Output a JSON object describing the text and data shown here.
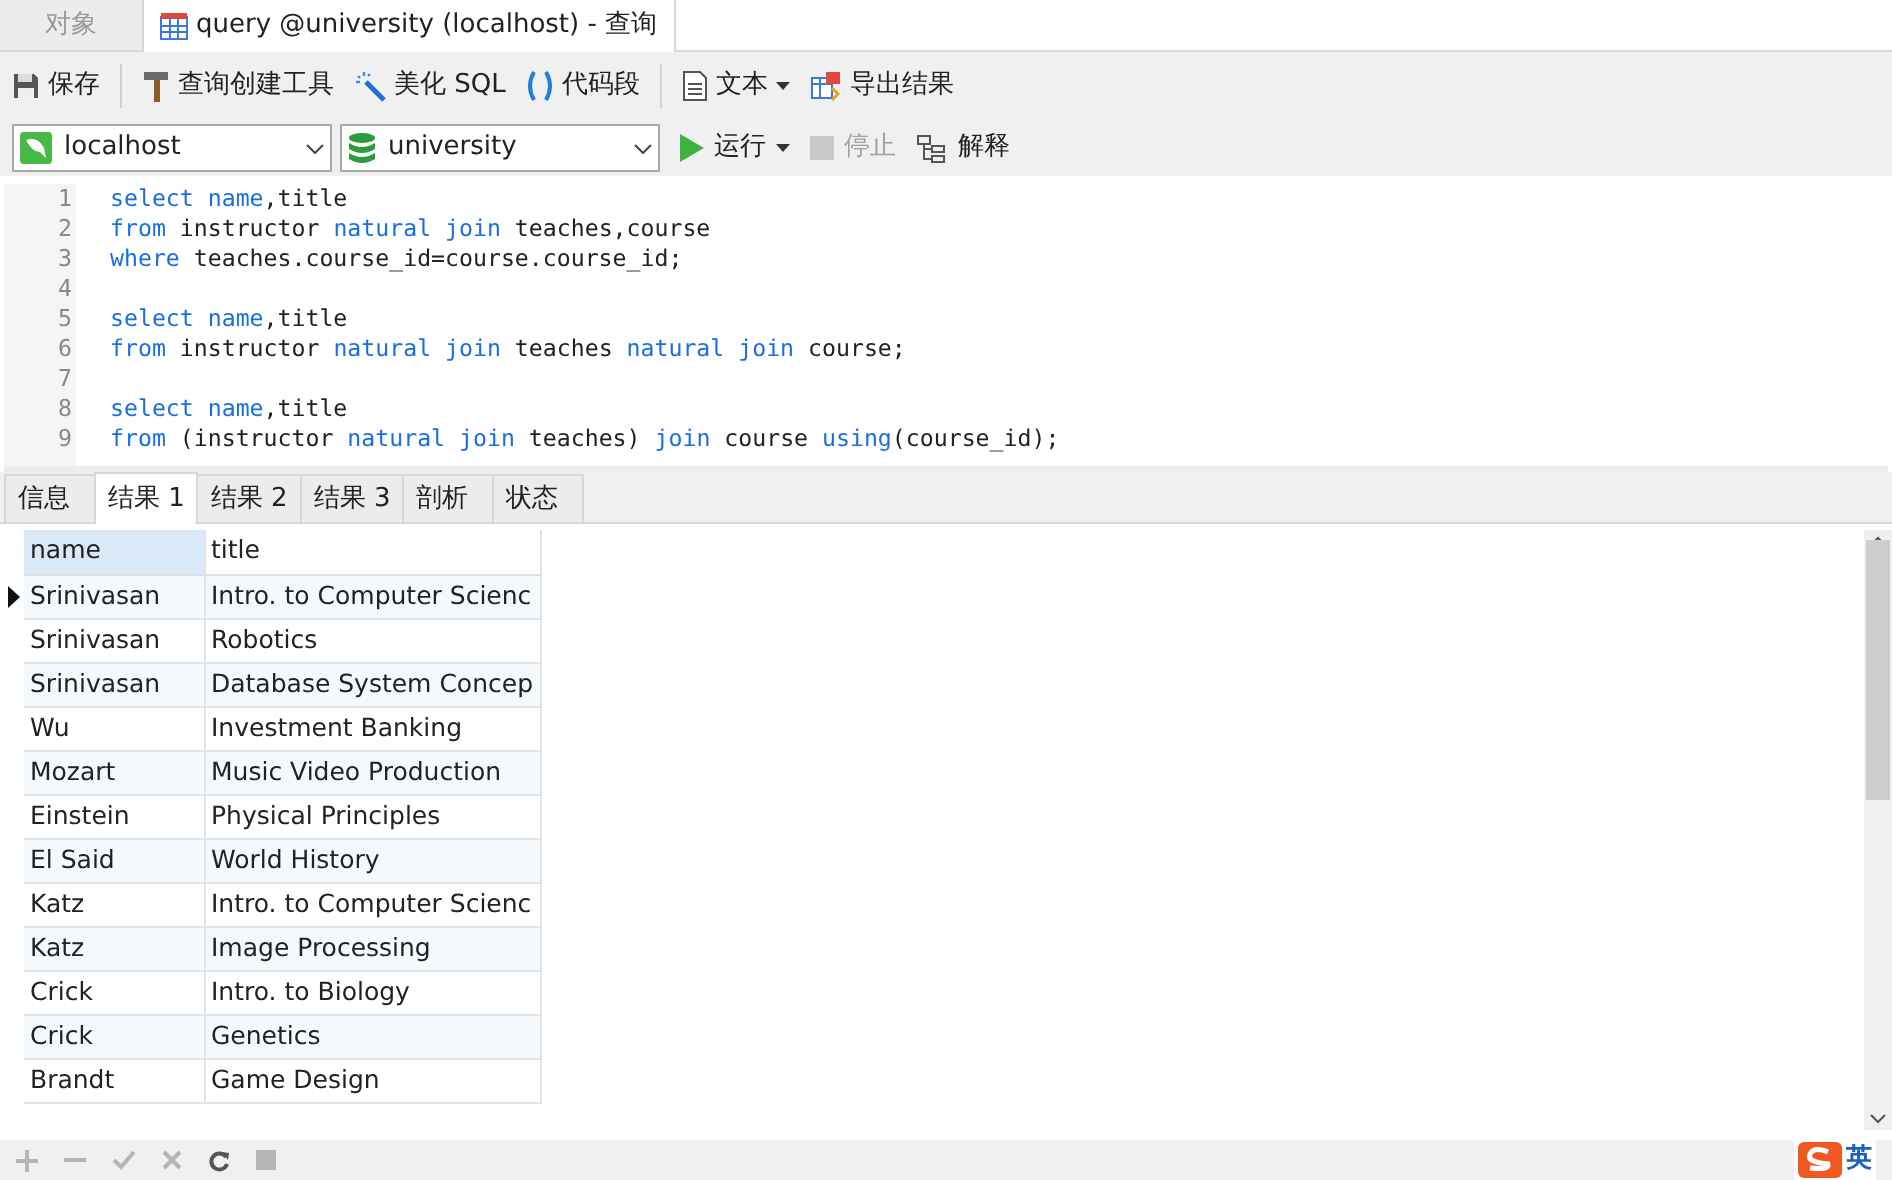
{
  "doc_tabs": [
    {
      "label": "对象",
      "selected": false,
      "icon": false
    },
    {
      "label": "query @university (localhost) - 查询",
      "selected": true,
      "icon": true
    }
  ],
  "toolbar": [
    {
      "kind": "save",
      "label": "保存"
    },
    {
      "kind": "sep"
    },
    {
      "kind": "builder",
      "label": "查询创建工具"
    },
    {
      "kind": "beautify",
      "label": "美化 SQL"
    },
    {
      "kind": "snippet",
      "label": "代码段"
    },
    {
      "kind": "sep"
    },
    {
      "kind": "text",
      "label": "文本",
      "caret": true
    },
    {
      "kind": "export",
      "label": "导出结果"
    }
  ],
  "connection": {
    "value": "localhost"
  },
  "database": {
    "value": "university"
  },
  "actions": [
    {
      "kind": "run",
      "label": "运行",
      "caret": true,
      "disabled": false
    },
    {
      "kind": "stop",
      "label": "停止",
      "disabled": true
    },
    {
      "kind": "explain",
      "label": "解释",
      "disabled": false
    }
  ],
  "editor": {
    "lines": [
      {
        "number": "1",
        "tokens": [
          {
            "text": "select name",
            "kw": true
          },
          {
            "text": ",title",
            "kw": false
          }
        ]
      },
      {
        "number": "2",
        "tokens": [
          {
            "text": "from",
            "kw": true
          },
          {
            "text": " instructor ",
            "kw": false
          },
          {
            "text": "natural join",
            "kw": true
          },
          {
            "text": " teaches,course",
            "kw": false
          }
        ]
      },
      {
        "number": "3",
        "tokens": [
          {
            "text": "where",
            "kw": true
          },
          {
            "text": " teaches.course_id=course.course_id;",
            "kw": false
          }
        ]
      },
      {
        "number": "4"
      },
      {
        "number": "5",
        "tokens": [
          {
            "text": "select name",
            "kw": true
          },
          {
            "text": ",title",
            "kw": false
          }
        ]
      },
      {
        "number": "6",
        "tokens": [
          {
            "text": "from",
            "kw": true
          },
          {
            "text": " instructor ",
            "kw": false
          },
          {
            "text": "natural join",
            "kw": true
          },
          {
            "text": " teaches ",
            "kw": false
          },
          {
            "text": "natural join",
            "kw": true
          },
          {
            "text": " course;",
            "kw": false
          }
        ]
      },
      {
        "number": "7"
      },
      {
        "number": "8",
        "tokens": [
          {
            "text": "select name",
            "kw": true
          },
          {
            "text": ",title",
            "kw": false
          }
        ]
      },
      {
        "number": "9",
        "tokens": [
          {
            "text": "from",
            "kw": true
          },
          {
            "text": " (instructor ",
            "kw": false
          },
          {
            "text": "natural join",
            "kw": true
          },
          {
            "text": " teaches) ",
            "kw": false
          },
          {
            "text": "join",
            "kw": true
          },
          {
            "text": " course ",
            "kw": false
          },
          {
            "text": "using",
            "kw": true
          },
          {
            "text": "(course_id);",
            "kw": false
          }
        ]
      }
    ]
  },
  "result_tabs": [
    {
      "label": "信息",
      "selected": false
    },
    {
      "label": "结果 1",
      "selected": true
    },
    {
      "label": "结果 2",
      "selected": false
    },
    {
      "label": "结果 3",
      "selected": false
    },
    {
      "label": "剖析",
      "selected": false
    },
    {
      "label": "状态",
      "selected": false
    }
  ],
  "table": {
    "columns": [
      "name",
      "title"
    ],
    "rows": [
      {
        "name": "Srinivasan",
        "title": "Intro. to Computer Scienc",
        "selected": true
      },
      {
        "name": "Srinivasan",
        "title": "Robotics",
        "selected": false
      },
      {
        "name": "Srinivasan",
        "title": "Database System Concep",
        "selected": false
      },
      {
        "name": "Wu",
        "title": "Investment Banking",
        "selected": false
      },
      {
        "name": "Mozart",
        "title": "Music Video Production",
        "selected": false
      },
      {
        "name": "Einstein",
        "title": "Physical Principles",
        "selected": false
      },
      {
        "name": "El Said",
        "title": "World History",
        "selected": false
      },
      {
        "name": "Katz",
        "title": "Intro. to Computer Scienc",
        "selected": false
      },
      {
        "name": "Katz",
        "title": "Image Processing",
        "selected": false
      },
      {
        "name": "Crick",
        "title": "Intro. to Biology",
        "selected": false
      },
      {
        "name": "Crick",
        "title": "Genetics",
        "selected": false
      },
      {
        "name": "Brandt",
        "title": "Game Design",
        "selected": false
      }
    ]
  },
  "bottom_bar": [
    {
      "kind": "add",
      "disabled": true
    },
    {
      "kind": "remove",
      "disabled": true
    },
    {
      "kind": "apply",
      "disabled": true
    },
    {
      "kind": "discard",
      "disabled": true
    },
    {
      "kind": "refresh",
      "disabled": false
    },
    {
      "kind": "stop",
      "disabled": true
    }
  ],
  "ime": {
    "label": "英"
  }
}
